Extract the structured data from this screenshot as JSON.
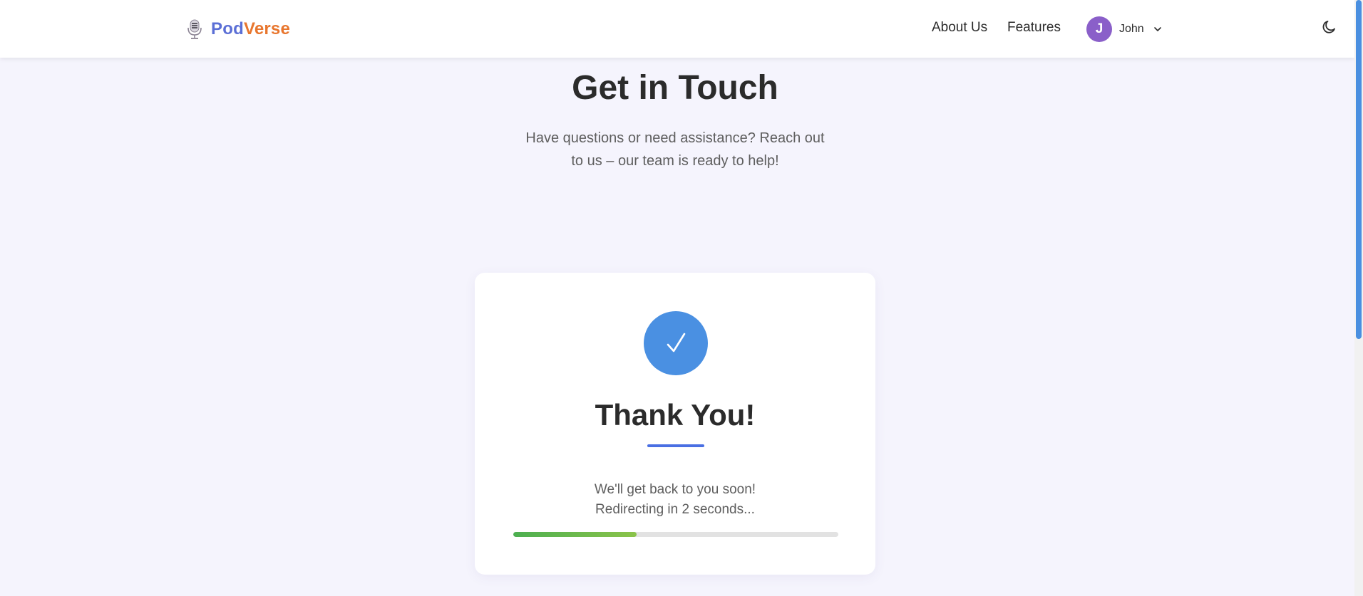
{
  "header": {
    "brand": {
      "part1": "Pod",
      "part2": "Verse",
      "logo_icon": "microphone-icon"
    },
    "nav": [
      {
        "label": "About Us"
      },
      {
        "label": "Features"
      }
    ],
    "user": {
      "initial": "J",
      "name": "John",
      "menu_icon": "chevron-down-icon"
    },
    "theme_toggle_icon": "moon-icon"
  },
  "main": {
    "title": "Get in Touch",
    "subtitle": "Have questions or need assistance? Reach out to us – our team is ready to help!"
  },
  "confirmation": {
    "icon": "checkmark-icon",
    "title": "Thank You!",
    "message_line1": "We'll get back to you soon!",
    "message_line2": "Redirecting in 2 seconds...",
    "progress_fraction": 0.38
  },
  "colors": {
    "page_background": "#f5f4fd",
    "brand_pod": "#5b6fd6",
    "brand_verse": "#e8762e",
    "avatar": "#8a5fc9",
    "check_circle": "#4a90e2",
    "underline": "#4a6fe3",
    "progress_start": "#4caf50",
    "progress_end": "#8bc34a",
    "scrollbar_thumb": "#4a8fe0"
  }
}
